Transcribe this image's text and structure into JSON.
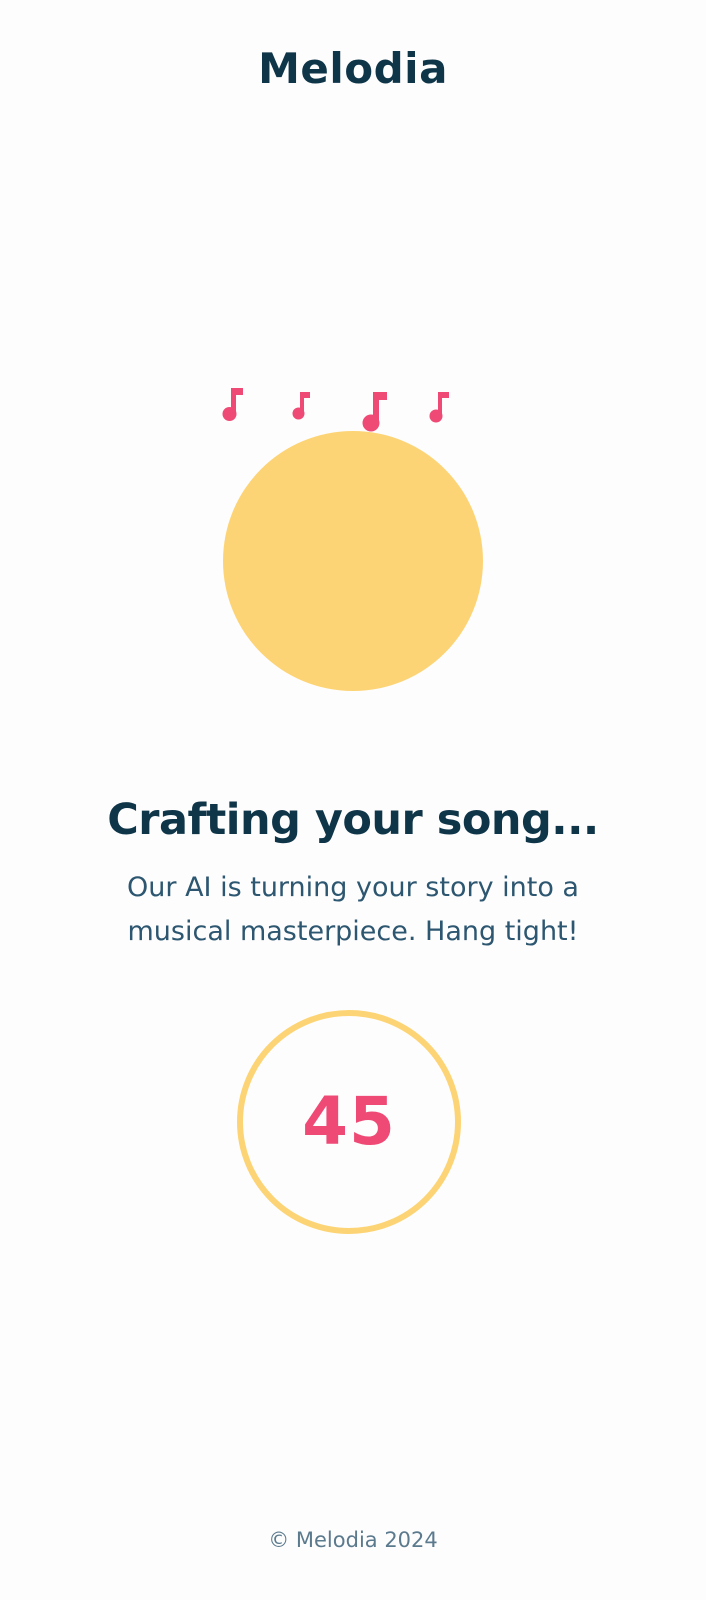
{
  "header": {
    "brand": "Melodia"
  },
  "loader": {
    "icons": [
      "music-note-icon",
      "music-note-icon",
      "music-note-icon",
      "music-note-icon"
    ],
    "blob_color": "#fdd475",
    "note_color": "#ef4a75"
  },
  "status": {
    "title": "Crafting your song...",
    "message": "Our AI is turning your story into a musical masterpiece. Hang tight!"
  },
  "countdown": {
    "value": "45",
    "ring_color": "#fdd475",
    "text_color": "#ef4a75"
  },
  "footer": {
    "copyright": "© Melodia 2024"
  },
  "colors": {
    "background": "#fdfdfd",
    "heading": "#0f3549",
    "body_text": "#2d5670",
    "muted": "#5c7a8e"
  }
}
